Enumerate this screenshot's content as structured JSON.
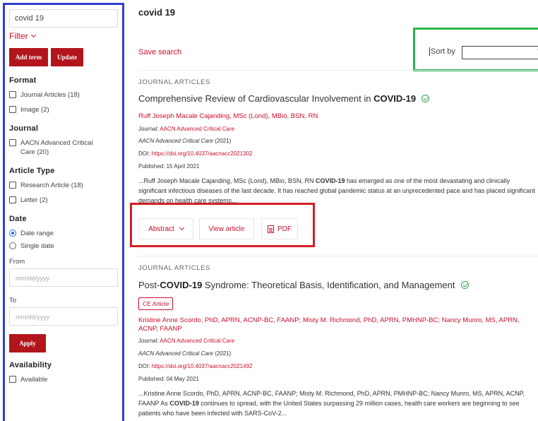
{
  "sidebar": {
    "search_value": "covid 19",
    "filter_label": "Filter",
    "add_term_label": "Add term",
    "update_label": "Update",
    "format": {
      "title": "Format",
      "options": [
        "Journal Articles (18)",
        "Image (2)"
      ]
    },
    "journal": {
      "title": "Journal",
      "options": [
        "AACN Advanced Critical Care (20)"
      ]
    },
    "article_type": {
      "title": "Article Type",
      "options": [
        "Research Article (18)",
        "Letter (2)"
      ]
    },
    "date": {
      "title": "Date",
      "options": [
        {
          "label": "Date range",
          "selected": true
        },
        {
          "label": "Single date",
          "selected": false
        }
      ],
      "from_label": "From",
      "from_placeholder": "mm/dd/yyyy",
      "to_label": "To",
      "to_placeholder": "mm/dd/yyyy"
    },
    "apply_label": "Apply",
    "availability_title": "Availability",
    "availability_option": "Available"
  },
  "main": {
    "query": "covid 19",
    "save_search": "Save search",
    "sort_label": "Sort by",
    "results": [
      {
        "type": "JOURNAL ARTICLES",
        "title_prefix": "Comprehensive Review of Cardiovascular Involvement in ",
        "title_bold": "COVID-19",
        "title_suffix": "",
        "badge": "",
        "authors": "Ruff Joseph Macale Cajanding, MSc (Lond), MBio, BSN, RN",
        "journal_label": "Journal:",
        "journal": "AACN Advanced Critical Care",
        "citation_journal": "AACN Advanced Critical Care",
        "citation_year": "(2021)",
        "doi_label": "DOI:",
        "doi": "https://doi.org/10.4037/aacnacc2021302",
        "published": "Published: 15 April 2021",
        "snippet_pre": "...Ruff Joseph Macale Cajanding, MSc (Lond), MBio, BSN, RN ",
        "snippet_bold": "COVID-19",
        "snippet_post": " has emerged as one of the most devastating and clinically significant infectious diseases of the last decade. It has reached global pandemic status at an unprecedented pace and has placed significant demands on health care systems...",
        "actions": {
          "abstract": "Abstract",
          "view": "View article",
          "pdf": "PDF"
        }
      },
      {
        "type": "JOURNAL ARTICLES",
        "title_prefix": "Post-",
        "title_bold": "COVID-19",
        "title_suffix": " Syndrome: Theoretical Basis, Identification, and Management",
        "badge": "CE Article",
        "authors": "Kristine Anne Scordo, PhD, APRN, ACNP-BC, FAANP; Misty M. Richmond, PhD, APRN, PMHNP-BC; Nancy Munro, MS, APRN, ACNP, FAANP",
        "journal_label": "Journal:",
        "journal": "AACN Advanced Critical Care",
        "citation_journal": "AACN Advanced Critical Care",
        "citation_year": "(2021)",
        "doi_label": "DOI:",
        "doi": "https://doi.org/10.4037/aacnacc2021492",
        "published": "Published: 04 May 2021",
        "snippet_pre": "...Kristine Anne Scordo, PhD, APRN, ACNP-BC, FAANP; Misty M. Richmond, PhD, APRN, PMHNP-BC; Nancy Munro, MS, APRN, ACNP, FAANP As ",
        "snippet_bold": "COVID-19",
        "snippet_post": " continues to spread, with the United States surpassing 29 million cases, health care workers are beginning to see patients who have been infected with SARS-CoV-2..."
      }
    ]
  }
}
